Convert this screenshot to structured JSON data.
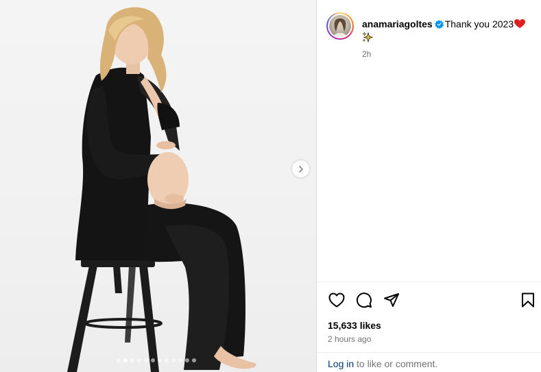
{
  "post": {
    "username": "anamariagoltes",
    "caption_text": "Thank you 2023",
    "posted_short": "2h",
    "likes_text": "15,633 likes",
    "posted_long": "2 hours ago"
  },
  "footer": {
    "login_link": "Log in",
    "login_rest": " to like or comment."
  },
  "icons": {
    "verified": "verified-badge-icon",
    "heart_emoji": "red-heart-emoji",
    "sparkle": "sparkles-emoji",
    "like": "heart-outline-icon",
    "comment": "comment-bubble-icon",
    "share": "paper-plane-icon",
    "save": "bookmark-icon",
    "next": "chevron-right-icon"
  },
  "colors": {
    "verified_blue": "#0095f6",
    "link_blue": "#00376b",
    "muted": "#737373",
    "heart_red": "#e0201f"
  },
  "carousel": {
    "slide_count": 12,
    "active_index": 1
  }
}
